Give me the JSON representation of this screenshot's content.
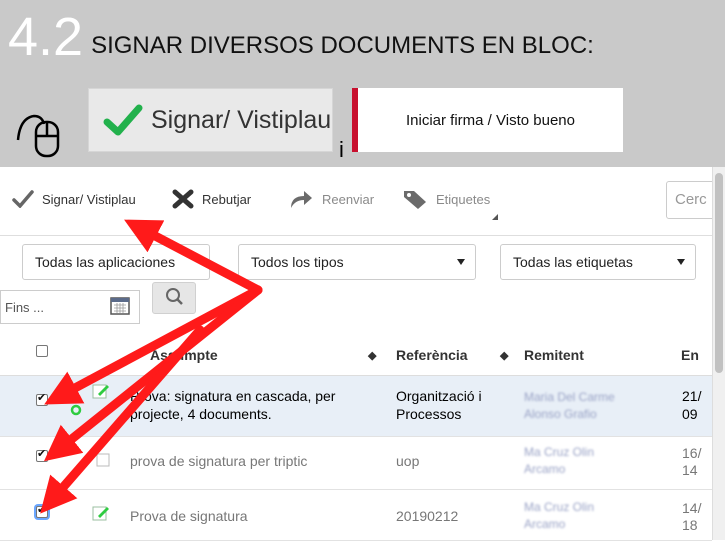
{
  "banner": {
    "number": "4.2",
    "title": "SIGNAR DIVERSOS DOCUMENTS EN BLOC:",
    "sign_button": "Signar/ Vistiplau",
    "conjunction": "i",
    "firma_button": "Iniciar firma / Visto bueno"
  },
  "toolbar": {
    "sign": "Signar/ Vistiplau",
    "reject": "Rebutjar",
    "forward": "Reenviar",
    "labels": "Etiquetes",
    "search_placeholder": "Cerc"
  },
  "filters": {
    "apps": "Todas las aplicaciones",
    "types": "Todos los tipos",
    "tags": "Todas las etiquetas",
    "until_placeholder": "Fins ..."
  },
  "table": {
    "headers": {
      "subject": "Assumpte",
      "reference": "Referència",
      "sender": "Remitent",
      "date": "En"
    },
    "rows": [
      {
        "subject_l1": "Prova: signatura en cascada, per",
        "subject_l2": "projecte, 4 documents.",
        "reference_l1": "Organització i",
        "reference_l2": "Processos",
        "sender_l1": "Maria Del Carme",
        "sender_l2": "Alonso Grafio",
        "date_l1": "21/",
        "date_l2": "09",
        "checked": true,
        "selected": true
      },
      {
        "subject_l1": "prova de signatura per triptic",
        "subject_l2": "",
        "reference_l1": "uop",
        "reference_l2": "",
        "sender_l1": "Ma Cruz Olin",
        "sender_l2": "Arcamo",
        "date_l1": "16/",
        "date_l2": "14",
        "checked": true,
        "selected": false
      },
      {
        "subject_l1": "Prova de signatura",
        "subject_l2": "",
        "reference_l1": "20190212",
        "reference_l2": "",
        "sender_l1": "Ma Cruz Olin",
        "sender_l2": "Arcamo",
        "date_l1": "14/",
        "date_l2": "18",
        "checked": true,
        "selected": false
      }
    ]
  },
  "colors": {
    "accent_green": "#2ecc40",
    "accent_red": "#ff1a1a",
    "banner_bg": "#c9c9c9",
    "firma_border": "#c8102e"
  },
  "icons": [
    "mouse-click-icon",
    "checkmark-icon",
    "cross-icon",
    "forward-icon",
    "tag-icon",
    "calendar-icon",
    "search-icon",
    "edit-icon",
    "gear-icon",
    "arrow-icon"
  ]
}
